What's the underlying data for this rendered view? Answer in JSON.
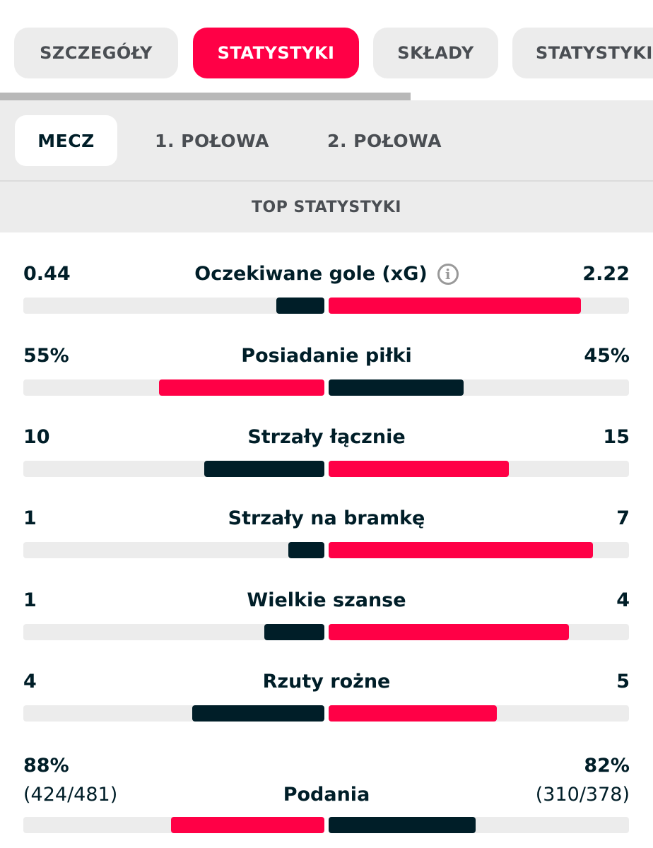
{
  "tabs": [
    {
      "label": "SZCZEGÓŁY",
      "active": false
    },
    {
      "label": "STATYSTYKI",
      "active": true
    },
    {
      "label": "SKŁADY",
      "active": false
    },
    {
      "label": "STATYSTYKI",
      "active": false
    }
  ],
  "subtabs": [
    {
      "label": "MECZ",
      "active": true
    },
    {
      "label": "1. POŁOWA",
      "active": false
    },
    {
      "label": "2. POŁOWA",
      "active": false
    }
  ],
  "section_title": "TOP STATYSTYKI",
  "colors": {
    "accent": "#ff0046",
    "dark": "#001e28",
    "track": "#ececec"
  },
  "stats": [
    {
      "label": "Oczekiwane gole (xG)",
      "home": "0.44",
      "away": "2.22",
      "home_fill": 0.16,
      "away_fill": 0.84,
      "home_color": "dark",
      "away_color": "red",
      "info_icon": true
    },
    {
      "label": "Posiadanie piłki",
      "home": "55%",
      "away": "45%",
      "home_fill": 0.55,
      "away_fill": 0.45,
      "home_color": "red",
      "away_color": "dark"
    },
    {
      "label": "Strzały łącznie",
      "home": "10",
      "away": "15",
      "home_fill": 0.4,
      "away_fill": 0.6,
      "home_color": "dark",
      "away_color": "red"
    },
    {
      "label": "Strzały na bramkę",
      "home": "1",
      "away": "7",
      "home_fill": 0.12,
      "away_fill": 0.88,
      "home_color": "dark",
      "away_color": "red"
    },
    {
      "label": "Wielkie szanse",
      "home": "1",
      "away": "4",
      "home_fill": 0.2,
      "away_fill": 0.8,
      "home_color": "dark",
      "away_color": "red"
    },
    {
      "label": "Rzuty rożne",
      "home": "4",
      "away": "5",
      "home_fill": 0.44,
      "away_fill": 0.56,
      "home_color": "dark",
      "away_color": "red"
    }
  ],
  "passes": {
    "label": "Podania",
    "home_pct": "88%",
    "home_detail": "(424/481)",
    "away_pct": "82%",
    "away_detail": "(310/378)",
    "home_fill": 0.51,
    "away_fill": 0.49,
    "home_color": "red",
    "away_color": "dark"
  }
}
